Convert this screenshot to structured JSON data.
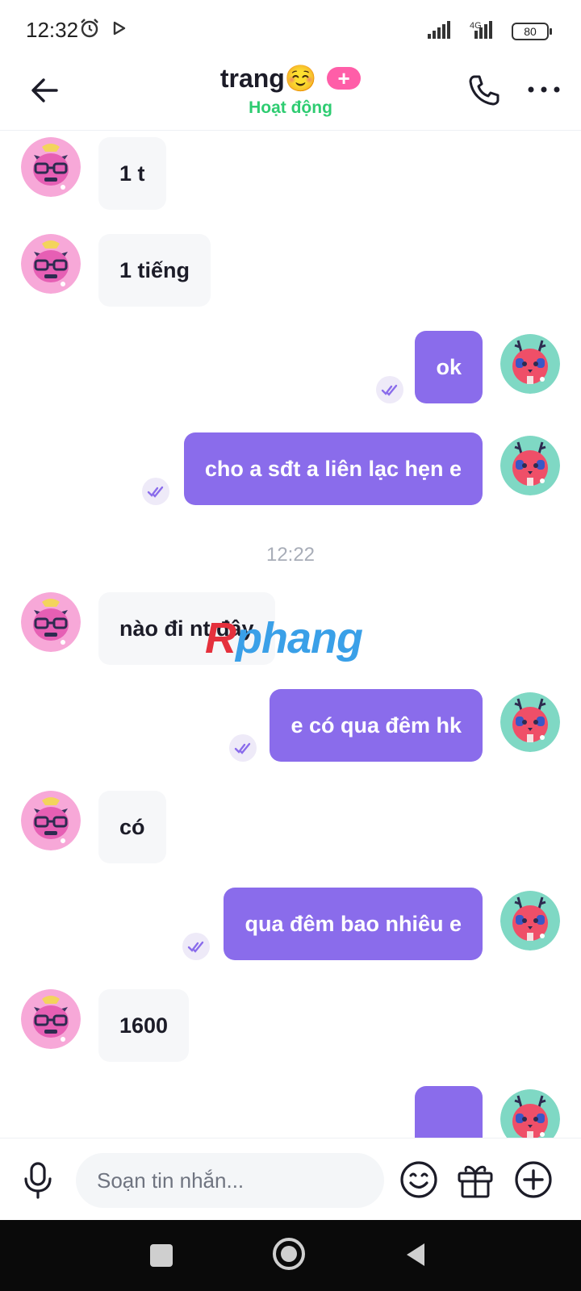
{
  "status_bar": {
    "time": "12:32",
    "network": "4G",
    "battery": "80"
  },
  "header": {
    "title": "trang☺️",
    "plus_badge": "+",
    "status": "Hoạt động"
  },
  "messages": [
    {
      "dir": "in",
      "text": "1 t"
    },
    {
      "dir": "in",
      "text": "1 tiếng"
    },
    {
      "dir": "out",
      "text": "ok"
    },
    {
      "dir": "out",
      "text": "cho a sđt a liên lạc hẹn e"
    },
    {
      "dir": "in",
      "text": "nào đi nt đây"
    },
    {
      "dir": "out",
      "text": "e có qua đêm hk"
    },
    {
      "dir": "in",
      "text": "có"
    },
    {
      "dir": "out",
      "text": "qua đêm bao nhiêu e"
    },
    {
      "dir": "in",
      "text": "1600"
    },
    {
      "dir": "out",
      "text": ""
    }
  ],
  "time_separator": "12:22",
  "watermark": {
    "part1": "R",
    "part2": "phang"
  },
  "composer": {
    "placeholder": "Soạn tin nhắn..."
  },
  "icons": {
    "back": "arrow-left-icon",
    "call": "phone-icon",
    "more": "more-horizontal-icon",
    "mic": "microphone-icon",
    "emoji": "smiley-icon",
    "gift": "gift-icon",
    "add": "plus-circle-icon",
    "read": "double-check-icon"
  },
  "colors": {
    "outgoing_bubble": "#8a6ceb",
    "incoming_bubble": "#f6f7f9",
    "active_status": "#2ecc71",
    "plus_badge": "#ff5ea8"
  }
}
